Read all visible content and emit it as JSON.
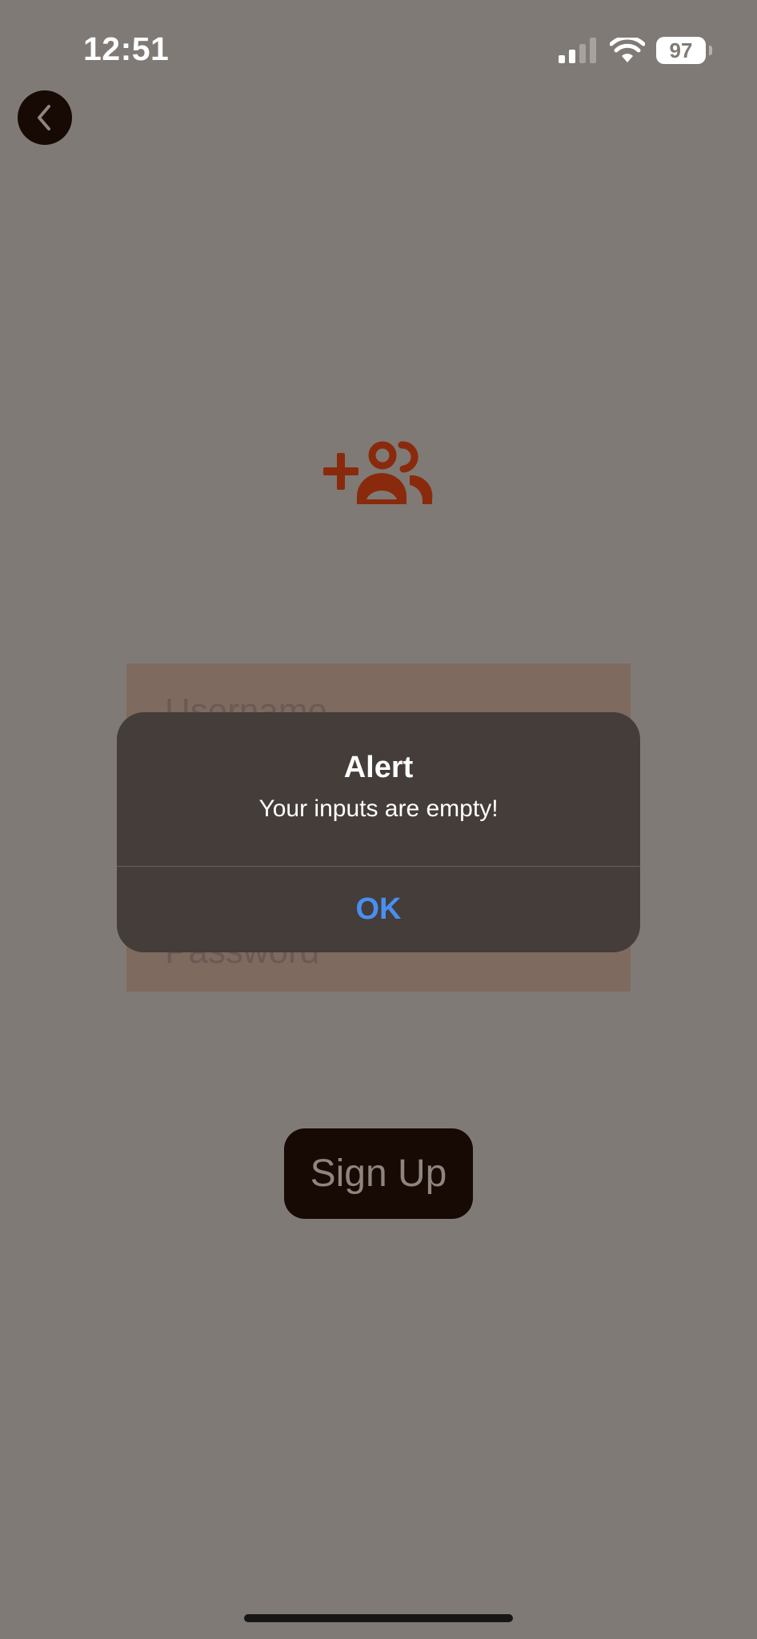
{
  "status_bar": {
    "time": "12:51",
    "battery": "97",
    "icons": [
      "signal-icon",
      "wifi-icon",
      "battery-icon"
    ]
  },
  "nav": {
    "back_icon": "chevron-left-icon"
  },
  "header": {
    "icon": "add-group-icon",
    "icon_color": "#8a2a0c"
  },
  "form": {
    "username_placeholder": "Username",
    "password_placeholder": "Password"
  },
  "actions": {
    "signup_label": "Sign Up"
  },
  "alert": {
    "title": "Alert",
    "message": "Your inputs are empty!",
    "ok_label": "OK",
    "ok_color": "#4a8ff0"
  }
}
